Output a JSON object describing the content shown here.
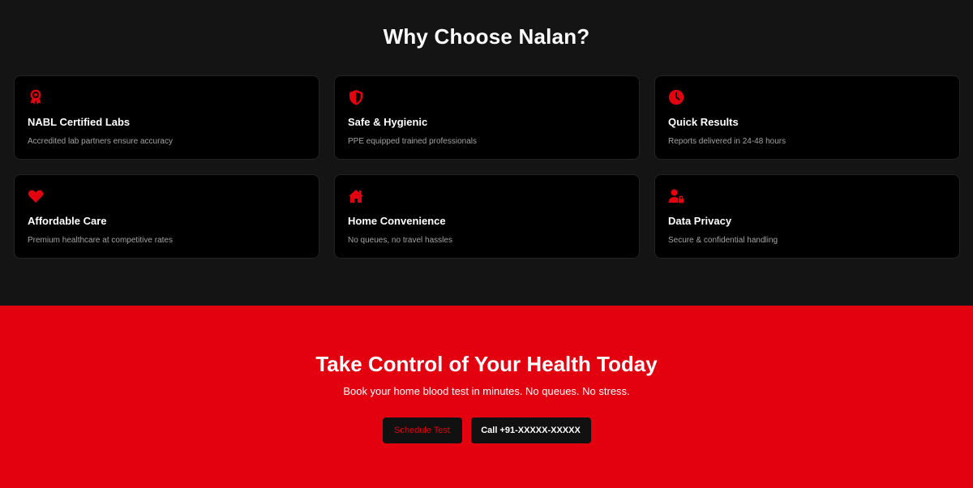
{
  "why": {
    "title": "Why Choose Nalan?",
    "features": [
      {
        "icon": "award-icon",
        "title": "NABL Certified Labs",
        "desc": "Accredited lab partners ensure accuracy"
      },
      {
        "icon": "shield-icon",
        "title": "Safe & Hygienic",
        "desc": "PPE equipped trained professionals"
      },
      {
        "icon": "clock-icon",
        "title": "Quick Results",
        "desc": "Reports delivered in 24-48 hours"
      },
      {
        "icon": "heart-icon",
        "title": "Affordable Care",
        "desc": "Premium healthcare at competitive rates"
      },
      {
        "icon": "home-icon",
        "title": "Home Convenience",
        "desc": "No queues, no travel hassles"
      },
      {
        "icon": "user-lock-icon",
        "title": "Data Privacy",
        "desc": "Secure & confidential handling"
      }
    ]
  },
  "cta": {
    "title": "Take Control of Your Health Today",
    "subtitle": "Book your home blood test in minutes. No queues. No stress.",
    "schedule_label": "Schedule Test",
    "call_label": "Call +91-XXXXX-XXXXX"
  },
  "colors": {
    "accent": "#e3000f",
    "dark_bg": "#141414",
    "card_bg": "#000000"
  }
}
